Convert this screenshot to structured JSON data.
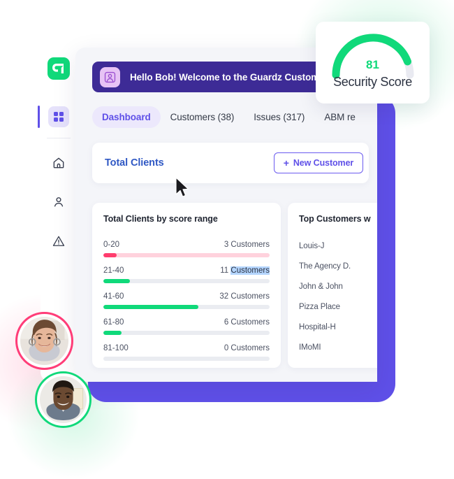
{
  "brand": {
    "logo_icon": "guardz-logo-icon",
    "logo_color": "#10d97a"
  },
  "sidebar": {
    "items": [
      {
        "name": "dashboard",
        "icon": "grid-icon",
        "active": true
      },
      {
        "name": "home",
        "icon": "home-icon",
        "active": false
      },
      {
        "name": "users",
        "icon": "person-icon",
        "active": false
      },
      {
        "name": "alerts",
        "icon": "warning-triangle-icon",
        "active": false
      }
    ]
  },
  "banner": {
    "icon": "contact-card-icon",
    "text": "Hello Bob! Welcome to the Guardz Customers Portal",
    "bg_color": "#3d2b96"
  },
  "tabs": [
    {
      "label": "Dashboard",
      "active": true
    },
    {
      "label": "Customers (38)",
      "active": false
    },
    {
      "label": "Issues (317)",
      "active": false
    },
    {
      "label": "ABM re",
      "active": false
    }
  ],
  "clients_header": {
    "title": "Total Clients",
    "new_customer_label": "New Customer",
    "plus": "+",
    "accent_color": "#5f50e8"
  },
  "score_panel": {
    "title": "Total Clients by score range"
  },
  "top_customers": {
    "title": "Top Customers w",
    "items": [
      "Louis-J",
      "The Agency D.",
      "John & John",
      "Pizza Place",
      "Hospital-H",
      "IMoMI"
    ]
  },
  "security_score": {
    "label": "Security Score",
    "value": "81",
    "value_color": "#10d97a",
    "track_color": "#e9eaf1"
  },
  "avatars": [
    {
      "name": "avatar-woman",
      "ring_color": "#ff3d78"
    },
    {
      "name": "avatar-man",
      "ring_color": "#10d97a"
    }
  ],
  "chart_data": {
    "type": "bar",
    "title": "Total Clients by score range",
    "orientation": "horizontal",
    "categories": [
      "0-20",
      "21-40",
      "41-60",
      "61-80",
      "81-100"
    ],
    "values": [
      3,
      11,
      32,
      6,
      0
    ],
    "value_labels": [
      "3 Customers",
      "11 Customers",
      "32 Customers",
      "6 Customers",
      "0 Customers"
    ],
    "count_numbers": [
      "3",
      "11",
      "32",
      "6",
      "0"
    ],
    "unit_word": "Customers",
    "bar_percents": [
      8,
      16,
      57,
      11,
      0
    ],
    "bar_colors": [
      "#ff3d6e",
      "#10d97a",
      "#10d97a",
      "#10d97a",
      "#eaecf1"
    ],
    "track_colors": [
      "#ffd2dd",
      "#eaecf1",
      "#eaecf1",
      "#eaecf1",
      "#eaecf1"
    ],
    "selected_row": 1,
    "selected_text": "Customers",
    "xlabel": "",
    "ylabel": "",
    "grid": false,
    "legend": "none"
  }
}
